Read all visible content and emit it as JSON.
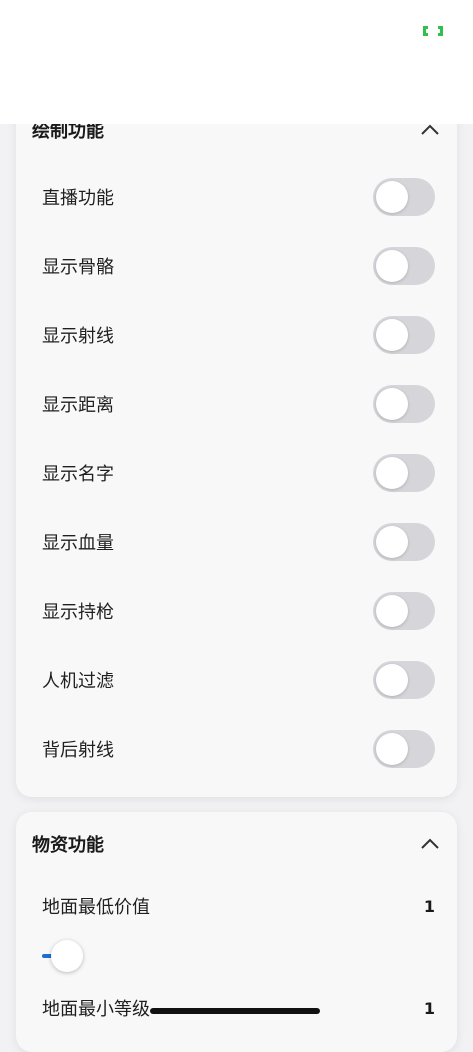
{
  "status_icon": "bracket-indicator-icon",
  "colors": {
    "accent_blue": "#1e6fd0",
    "indicator_green": "#2fc04e",
    "toggle_off": "#d6d6da"
  },
  "drawing": {
    "title": "绘制功能",
    "collapse_icon": "chevron-up-icon",
    "rows": [
      {
        "label": "直播功能",
        "on": false
      },
      {
        "label": "显示骨骼",
        "on": false
      },
      {
        "label": "显示射线",
        "on": false
      },
      {
        "label": "显示距离",
        "on": false
      },
      {
        "label": "显示名字",
        "on": false
      },
      {
        "label": "显示血量",
        "on": false
      },
      {
        "label": "显示持枪",
        "on": false
      },
      {
        "label": "人机过滤",
        "on": false
      },
      {
        "label": "背后射线",
        "on": false
      }
    ]
  },
  "items": {
    "title": "物资功能",
    "collapse_icon": "chevron-up-icon",
    "settings": [
      {
        "label": "地面最低价值",
        "value": "1"
      },
      {
        "label": "地面最小等级",
        "value": "1"
      }
    ]
  }
}
